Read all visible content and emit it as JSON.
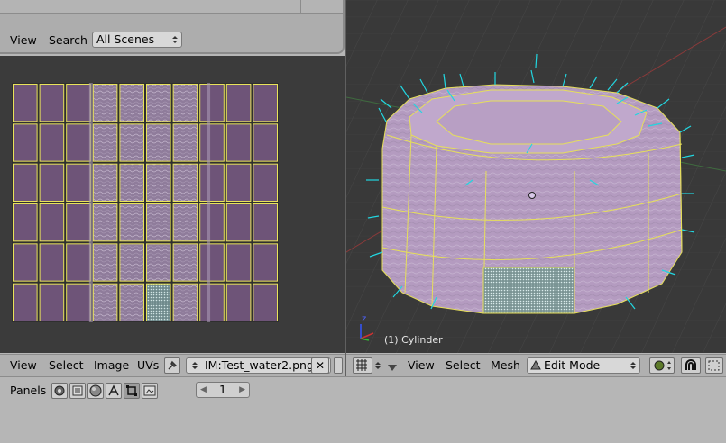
{
  "outliner": {
    "menu_view": "View",
    "menu_search": "Search",
    "scene_select": "All Scenes"
  },
  "uv_editor": {
    "menu_view": "View",
    "menu_select": "Select",
    "menu_image": "Image",
    "menu_uvs": "UVs",
    "image_name": "IM:Test_water2.png",
    "close_symbol": "✕",
    "grid_columns": 10,
    "grid_rows": 6,
    "selected_face": "row 6, column 6"
  },
  "viewport": {
    "object_label": "(1) Cylinder",
    "axis_z": "z",
    "menu_view": "View",
    "menu_select": "Select",
    "menu_mesh": "Mesh",
    "mode_select": "Edit Mode"
  },
  "buttons_window": {
    "panels_label": "Panels",
    "frame_value": "1",
    "prev_arrow": "◀",
    "next_arrow": "▶"
  },
  "colors": {
    "uv_background": "#3b3b3b",
    "uv_face": "#6e5478",
    "uv_edge": "#e9e35a",
    "viewport_bg": "#393939",
    "mesh_face": "#b49bc0",
    "normal_lines": "#22d6e0",
    "header_bg": "#b0b0b0"
  }
}
